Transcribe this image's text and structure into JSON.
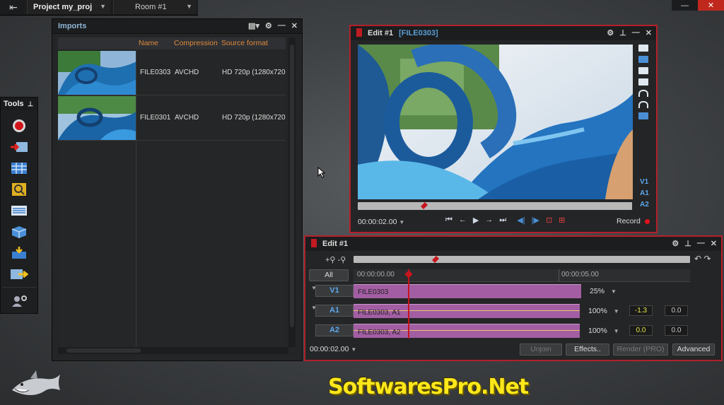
{
  "topbar": {
    "project": "Project my_proj",
    "room": "Room #1"
  },
  "window_controls": {
    "minimize": "—",
    "close": "✕"
  },
  "imports": {
    "title": "Imports",
    "columns": [
      "Name",
      "Compression",
      "Source format"
    ],
    "rows": [
      {
        "name": "FILE0303",
        "compression": "AVCHD",
        "format": "HD 720p (1280x720"
      },
      {
        "name": "FILE0301",
        "compression": "AVCHD",
        "format": "HD 720p (1280x720"
      }
    ]
  },
  "tools": {
    "title": "Tools",
    "items": [
      "record",
      "input",
      "edit",
      "search",
      "table",
      "cube",
      "render",
      "export",
      "settings"
    ]
  },
  "viewer": {
    "title": "Edit #1",
    "clip": "[FILE0303]",
    "timecode": "00:00:02.00",
    "record_label": "Record",
    "track_labels": [
      "V1",
      "A1",
      "A2"
    ]
  },
  "timeline": {
    "title": "Edit #1",
    "all_label": "All",
    "ruler": [
      "00:00:00.00",
      "00:00:05.00"
    ],
    "tracks": [
      {
        "name": "V1",
        "clip": "FILE0303",
        "level": "25%"
      },
      {
        "name": "A1",
        "clip": "FILE0303, A1",
        "level": "100%",
        "pan": "-1.3",
        "gain": "0.0"
      },
      {
        "name": "A2",
        "clip": "FILE0303, A2",
        "level": "100%",
        "pan": "0.0",
        "gain": "0.0"
      }
    ],
    "timecode": "00:00:02.00",
    "buttons": {
      "unjoin": "Unjoin",
      "effects": "Effects..",
      "render": "Render (PRO)",
      "advanced": "Advanced"
    }
  },
  "watermark": "SoftwaresPro.Net",
  "colors": {
    "accent_red": "#b3202a",
    "clip_purple": "#a35ea3",
    "header_orange": "#e08a3c",
    "track_blue": "#5ca8ee"
  }
}
